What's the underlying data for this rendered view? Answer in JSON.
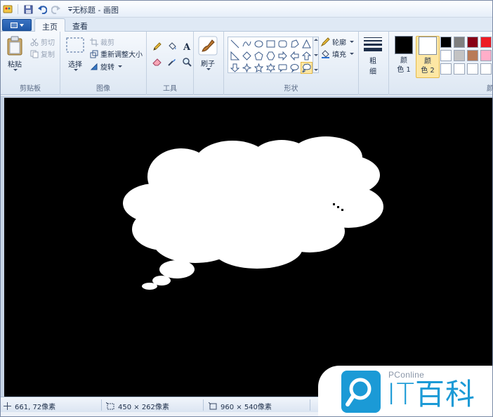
{
  "window": {
    "title": "无标题 - 画图"
  },
  "quick_access": {
    "icons": [
      "paint-app-icon",
      "save-icon",
      "undo-icon",
      "redo-icon",
      "customize-dropdown-icon"
    ]
  },
  "tabs": [
    {
      "label": "主页",
      "active": true
    },
    {
      "label": "查看",
      "active": false
    }
  ],
  "ribbon": {
    "clipboard": {
      "group_label": "剪贴板",
      "paste_label": "粘贴",
      "cut_label": "剪切",
      "copy_label": "复制"
    },
    "image": {
      "group_label": "图像",
      "select_label": "选择",
      "crop_label": "裁剪",
      "resize_label": "重新调整大小",
      "rotate_label": "旋转"
    },
    "tools": {
      "group_label": "工具",
      "items": [
        "pencil-icon",
        "fill-icon",
        "text-icon",
        "eraser-icon",
        "color-picker-icon",
        "magnifier-icon"
      ]
    },
    "brushes": {
      "label": "刷子"
    },
    "shapes": {
      "group_label": "形状",
      "outline_label": "轮廓",
      "fill_label": "填充",
      "selected_shape": "thought-bubble"
    },
    "size": {
      "label_1": "粗",
      "label_2": "细"
    },
    "colors": {
      "group_label": "颜",
      "color1_label_1": "颜",
      "color1_label_2": "色 1",
      "color2_label_1": "颜",
      "color2_label_2": "色 2",
      "color1": "#000000",
      "color2": "#ffffff",
      "palette": [
        "#000000",
        "#7f7f7f",
        "#880015",
        "#ed1c24",
        "#ffffff",
        "#c3c3c3",
        "#b97a57",
        "#ffaec9",
        "#ffffff",
        "#ffffff",
        "#ffffff",
        "#ffffff"
      ]
    }
  },
  "canvas": {
    "background": "#000000",
    "shape_fill": "#ffffff"
  },
  "statusbar": {
    "cursor_pos": "661, 72像素",
    "selection_size": "450 × 262像素",
    "image_size": "960 × 540像素"
  },
  "watermark": {
    "small_text": "PConline",
    "big_text": "IT百科",
    "brand_color": "#1b9ad6"
  }
}
